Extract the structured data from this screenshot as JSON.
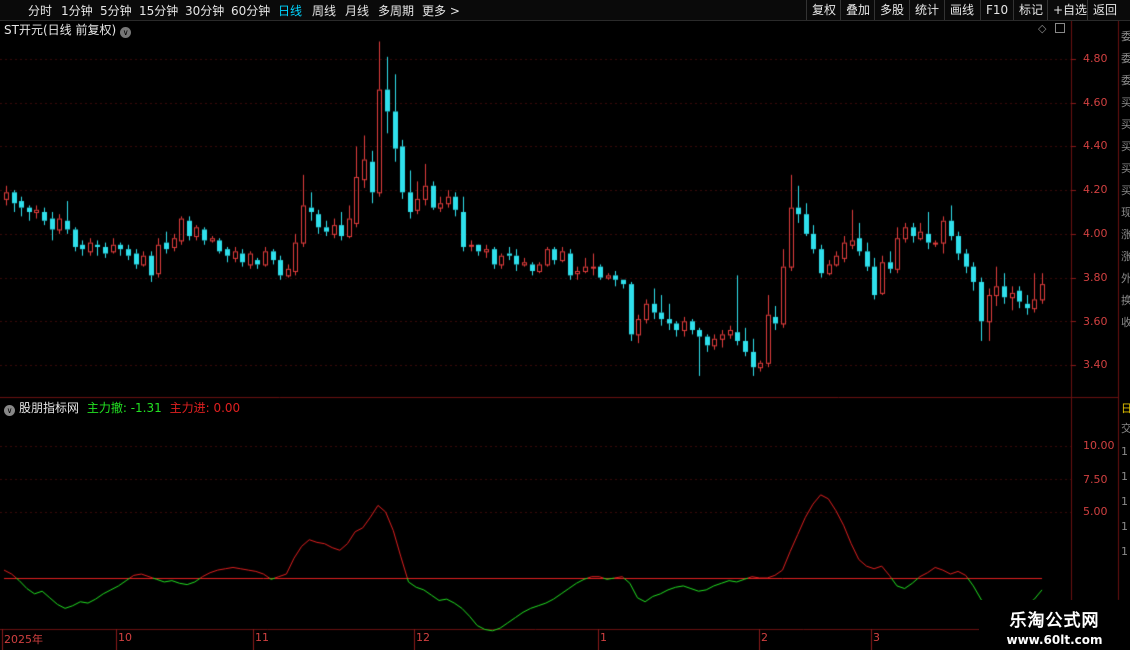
{
  "toolbar": {
    "periods": [
      "分时",
      "1分钟",
      "5分钟",
      "15分钟",
      "30分钟",
      "60分钟",
      "日线",
      "周线",
      "月线",
      "多周期",
      "更多"
    ],
    "active": "日线",
    "right_buttons": [
      "复权",
      "叠加",
      "多股",
      "统计",
      "画线",
      "F10",
      "标记",
      "+自选",
      "返回"
    ]
  },
  "chart_title": "ST开元(日线 前复权)",
  "price_axis_labels": [
    "4.80",
    "4.60",
    "4.40",
    "4.20",
    "4.00",
    "3.80",
    "3.60",
    "3.40"
  ],
  "indicator": {
    "name": "股朋指标网",
    "outflow_label": "主力撤: -1.31",
    "inflow_label": "主力进: 0.00",
    "axis_labels": [
      "10.00",
      "7.50",
      "5.00"
    ]
  },
  "date_labels": [
    "2025年",
    "10",
    "11",
    "12",
    "1",
    "2",
    "3"
  ],
  "right_panel_glyphs": [
    "委",
    "委",
    "委",
    "买",
    "买",
    "买",
    "买",
    "买",
    "现",
    "涨",
    "涨",
    "外",
    "换",
    "收",
    "日",
    "交",
    "1",
    "1",
    "1",
    "1",
    "1"
  ],
  "logo": {
    "name": "乐淘公式网",
    "url": "www.60lt.com"
  },
  "colors": {
    "up": "#e03c3c",
    "down": "#2fe0ec",
    "grid": "#3a0a0a",
    "indicator_red": "#e02020",
    "indicator_green": "#22e022",
    "active": "#00d5ff"
  },
  "chart_data": {
    "type": "candlestick",
    "price_axis": {
      "ticks": [
        4.8,
        4.6,
        4.4,
        4.2,
        4.0,
        3.8,
        3.6,
        3.4
      ]
    },
    "date_ticks": [
      "2025年",
      "10",
      "11",
      "12",
      "1",
      "2",
      "3"
    ],
    "candles": [
      [
        4.16,
        4.19,
        4.22,
        4.13
      ],
      [
        4.19,
        4.14,
        4.2,
        4.1
      ],
      [
        4.15,
        4.12,
        4.17,
        4.08
      ],
      [
        4.12,
        4.1,
        4.13,
        4.06
      ],
      [
        4.1,
        4.11,
        4.13,
        4.07
      ],
      [
        4.1,
        4.06,
        4.12,
        4.04
      ],
      [
        4.07,
        4.02,
        4.1,
        3.97
      ],
      [
        4.02,
        4.07,
        4.09,
        4.0
      ],
      [
        4.06,
        4.02,
        4.15,
        4.0
      ],
      [
        4.02,
        3.94,
        4.03,
        3.92
      ],
      [
        3.95,
        3.93,
        3.97,
        3.9
      ],
      [
        3.92,
        3.96,
        3.98,
        3.9
      ],
      [
        3.95,
        3.94,
        3.97,
        3.9
      ],
      [
        3.94,
        3.91,
        3.96,
        3.89
      ],
      [
        3.92,
        3.95,
        3.98,
        3.91
      ],
      [
        3.95,
        3.93,
        3.96,
        3.9
      ],
      [
        3.93,
        3.9,
        3.95,
        3.88
      ],
      [
        3.91,
        3.86,
        3.93,
        3.84
      ],
      [
        3.86,
        3.9,
        3.92,
        3.85
      ],
      [
        3.9,
        3.81,
        3.92,
        3.78
      ],
      [
        3.82,
        3.95,
        3.98,
        3.8
      ],
      [
        3.96,
        3.93,
        4.01,
        3.91
      ],
      [
        3.94,
        3.98,
        4.0,
        3.92
      ],
      [
        3.97,
        4.07,
        4.08,
        3.95
      ],
      [
        4.06,
        3.99,
        4.08,
        3.97
      ],
      [
        3.99,
        4.03,
        4.04,
        3.97
      ],
      [
        4.02,
        3.97,
        4.03,
        3.95
      ],
      [
        3.97,
        3.98,
        3.99,
        3.96
      ],
      [
        3.97,
        3.92,
        3.98,
        3.91
      ],
      [
        3.93,
        3.9,
        3.94,
        3.87
      ],
      [
        3.89,
        3.92,
        3.94,
        3.87
      ],
      [
        3.91,
        3.87,
        3.93,
        3.85
      ],
      [
        3.86,
        3.91,
        3.92,
        3.84
      ],
      [
        3.88,
        3.86,
        3.89,
        3.84
      ],
      [
        3.86,
        3.92,
        3.94,
        3.85
      ],
      [
        3.92,
        3.88,
        3.93,
        3.86
      ],
      [
        3.88,
        3.81,
        3.9,
        3.79
      ],
      [
        3.81,
        3.84,
        3.86,
        3.8
      ],
      [
        3.83,
        3.96,
        4.0,
        3.81
      ],
      [
        3.96,
        4.13,
        4.27,
        3.94
      ],
      [
        4.12,
        4.1,
        4.19,
        4.06
      ],
      [
        4.09,
        4.03,
        4.11,
        4.0
      ],
      [
        4.03,
        4.01,
        4.06,
        3.99
      ],
      [
        4.0,
        4.04,
        4.07,
        3.98
      ],
      [
        4.04,
        3.99,
        4.1,
        3.97
      ],
      [
        3.99,
        4.07,
        4.13,
        3.98
      ],
      [
        4.05,
        4.26,
        4.4,
        4.03
      ],
      [
        4.25,
        4.34,
        4.45,
        4.21
      ],
      [
        4.33,
        4.19,
        4.38,
        4.14
      ],
      [
        4.19,
        4.66,
        4.88,
        4.17
      ],
      [
        4.66,
        4.56,
        4.81,
        4.46
      ],
      [
        4.56,
        4.39,
        4.73,
        4.33
      ],
      [
        4.4,
        4.19,
        4.43,
        4.16
      ],
      [
        4.19,
        4.1,
        4.29,
        4.07
      ],
      [
        4.11,
        4.16,
        4.24,
        4.09
      ],
      [
        4.16,
        4.22,
        4.32,
        4.13
      ],
      [
        4.22,
        4.12,
        4.24,
        4.11
      ],
      [
        4.12,
        4.14,
        4.17,
        4.1
      ],
      [
        4.14,
        4.17,
        4.2,
        4.12
      ],
      [
        4.17,
        4.11,
        4.19,
        4.08
      ],
      [
        4.1,
        3.94,
        4.17,
        3.92
      ],
      [
        3.95,
        3.95,
        3.97,
        3.92
      ],
      [
        3.95,
        3.92,
        3.94,
        3.9
      ],
      [
        3.92,
        3.93,
        3.95,
        3.89
      ],
      [
        3.93,
        3.86,
        3.94,
        3.84
      ],
      [
        3.86,
        3.9,
        3.91,
        3.84
      ],
      [
        3.91,
        3.9,
        3.94,
        3.88
      ],
      [
        3.9,
        3.86,
        3.93,
        3.83
      ],
      [
        3.86,
        3.87,
        3.89,
        3.85
      ],
      [
        3.86,
        3.83,
        3.87,
        3.81
      ],
      [
        3.83,
        3.86,
        3.87,
        3.82
      ],
      [
        3.86,
        3.93,
        3.94,
        3.85
      ],
      [
        3.93,
        3.88,
        3.94,
        3.86
      ],
      [
        3.88,
        3.92,
        3.94,
        3.87
      ],
      [
        3.91,
        3.81,
        3.93,
        3.79
      ],
      [
        3.82,
        3.83,
        3.85,
        3.79
      ],
      [
        3.83,
        3.85,
        3.89,
        3.82
      ],
      [
        3.85,
        3.85,
        3.91,
        3.81
      ],
      [
        3.85,
        3.8,
        3.86,
        3.79
      ],
      [
        3.8,
        3.81,
        3.82,
        3.79
      ],
      [
        3.81,
        3.79,
        3.83,
        3.76
      ],
      [
        3.79,
        3.77,
        3.79,
        3.75
      ],
      [
        3.77,
        3.54,
        3.78,
        3.51
      ],
      [
        3.54,
        3.61,
        3.63,
        3.5
      ],
      [
        3.61,
        3.68,
        3.7,
        3.59
      ],
      [
        3.68,
        3.64,
        3.75,
        3.61
      ],
      [
        3.64,
        3.61,
        3.72,
        3.58
      ],
      [
        3.61,
        3.59,
        3.68,
        3.56
      ],
      [
        3.59,
        3.56,
        3.6,
        3.53
      ],
      [
        3.56,
        3.6,
        3.62,
        3.53
      ],
      [
        3.6,
        3.56,
        3.61,
        3.54
      ],
      [
        3.56,
        3.53,
        3.57,
        3.35
      ],
      [
        3.53,
        3.49,
        3.54,
        3.46
      ],
      [
        3.49,
        3.52,
        3.54,
        3.47
      ],
      [
        3.52,
        3.54,
        3.56,
        3.48
      ],
      [
        3.54,
        3.56,
        3.58,
        3.52
      ],
      [
        3.55,
        3.51,
        3.81,
        3.49
      ],
      [
        3.51,
        3.46,
        3.57,
        3.44
      ],
      [
        3.46,
        3.39,
        3.52,
        3.35
      ],
      [
        3.39,
        3.41,
        3.42,
        3.37
      ],
      [
        3.41,
        3.63,
        3.72,
        3.39
      ],
      [
        3.62,
        3.59,
        3.67,
        3.56
      ],
      [
        3.59,
        3.85,
        3.93,
        3.57
      ],
      [
        3.85,
        4.12,
        4.27,
        3.83
      ],
      [
        4.12,
        4.09,
        4.22,
        4.05
      ],
      [
        4.09,
        4.0,
        4.14,
        3.99
      ],
      [
        4.0,
        3.93,
        4.04,
        3.91
      ],
      [
        3.93,
        3.82,
        3.95,
        3.8
      ],
      [
        3.82,
        3.86,
        3.88,
        3.81
      ],
      [
        3.86,
        3.9,
        3.92,
        3.85
      ],
      [
        3.89,
        3.96,
        3.99,
        3.87
      ],
      [
        3.95,
        3.97,
        4.11,
        3.93
      ],
      [
        3.98,
        3.92,
        4.05,
        3.9
      ],
      [
        3.92,
        3.85,
        3.96,
        3.83
      ],
      [
        3.85,
        3.72,
        3.89,
        3.7
      ],
      [
        3.73,
        3.87,
        3.9,
        3.72
      ],
      [
        3.87,
        3.84,
        3.92,
        3.82
      ],
      [
        3.84,
        3.98,
        4.03,
        3.82
      ],
      [
        3.98,
        4.03,
        4.05,
        3.96
      ],
      [
        4.03,
        3.99,
        4.05,
        3.96
      ],
      [
        3.98,
        4.01,
        4.05,
        3.97
      ],
      [
        4.0,
        3.96,
        4.1,
        3.93
      ],
      [
        3.96,
        3.96,
        3.97,
        3.94
      ],
      [
        3.96,
        4.06,
        4.08,
        3.91
      ],
      [
        4.06,
        3.99,
        4.13,
        3.97
      ],
      [
        3.99,
        3.91,
        4.01,
        3.88
      ],
      [
        3.91,
        3.85,
        3.93,
        3.82
      ],
      [
        3.85,
        3.78,
        3.87,
        3.74
      ],
      [
        3.78,
        3.6,
        3.8,
        3.51
      ],
      [
        3.6,
        3.72,
        3.75,
        3.51
      ],
      [
        3.72,
        3.76,
        3.85,
        3.67
      ],
      [
        3.76,
        3.71,
        3.82,
        3.68
      ],
      [
        3.71,
        3.73,
        3.76,
        3.65
      ],
      [
        3.74,
        3.69,
        3.76,
        3.66
      ],
      [
        3.68,
        3.66,
        3.72,
        3.63
      ],
      [
        3.66,
        3.7,
        3.82,
        3.64
      ],
      [
        3.7,
        3.77,
        3.82,
        3.68
      ]
    ],
    "indicator_line": {
      "baseline": 0,
      "values": [
        0.6,
        0.3,
        -0.2,
        -0.8,
        -1.2,
        -1.0,
        -1.5,
        -2.0,
        -2.3,
        -2.1,
        -1.8,
        -1.9,
        -1.6,
        -1.2,
        -0.9,
        -0.6,
        -0.2,
        0.2,
        0.3,
        0.1,
        -0.1,
        -0.3,
        -0.2,
        -0.4,
        -0.5,
        -0.3,
        0.1,
        0.4,
        0.6,
        0.7,
        0.8,
        0.7,
        0.6,
        0.5,
        0.3,
        -0.1,
        0.1,
        0.3,
        1.5,
        2.4,
        2.9,
        2.7,
        2.6,
        2.3,
        2.1,
        2.6,
        3.5,
        3.8,
        4.6,
        5.5,
        5.0,
        3.6,
        1.6,
        -0.3,
        -0.7,
        -0.9,
        -1.3,
        -1.7,
        -1.6,
        -1.9,
        -2.3,
        -2.9,
        -3.6,
        -3.9,
        -4.0,
        -3.8,
        -3.4,
        -3.0,
        -2.6,
        -2.3,
        -2.1,
        -1.9,
        -1.6,
        -1.2,
        -0.8,
        -0.4,
        -0.1,
        0.1,
        0.1,
        -0.1,
        0.0,
        0.1,
        -0.4,
        -1.5,
        -1.8,
        -1.4,
        -1.2,
        -0.9,
        -0.7,
        -0.6,
        -0.8,
        -1.0,
        -0.9,
        -0.6,
        -0.4,
        -0.2,
        -0.3,
        -0.1,
        0.1,
        0.0,
        0.0,
        0.2,
        0.6,
        2.0,
        3.3,
        4.6,
        5.6,
        6.3,
        6.0,
        5.1,
        4.0,
        2.6,
        1.4,
        0.9,
        0.7,
        0.9,
        0.2,
        -0.6,
        -0.8,
        -0.4,
        0.1,
        0.4,
        0.8,
        0.6,
        0.3,
        0.5,
        0.2,
        -0.6,
        -1.6,
        -2.8,
        -3.2,
        -2.9,
        -2.6,
        -2.4,
        -2.1,
        -1.6,
        -0.9
      ]
    }
  }
}
